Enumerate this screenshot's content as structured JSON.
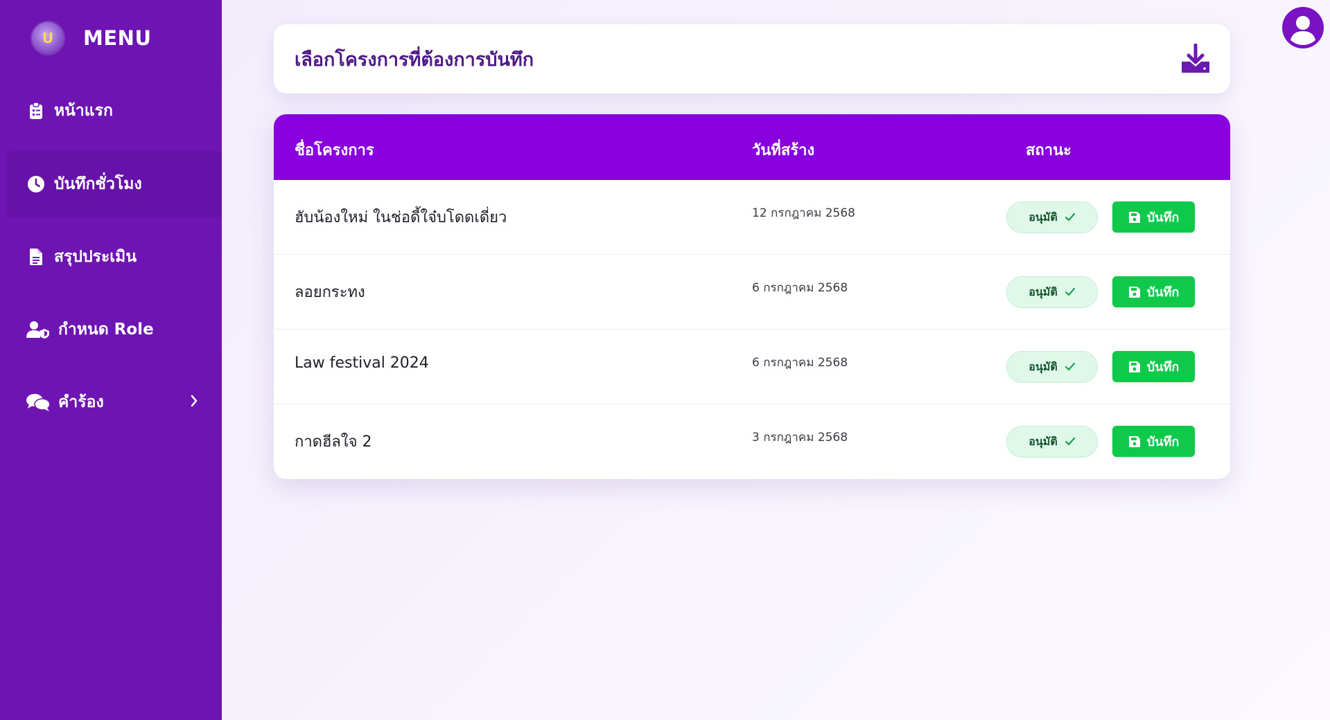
{
  "sidebar": {
    "logo_text": "U",
    "title": "MENU",
    "items": [
      {
        "label": "หน้าแรก",
        "icon": "clipboard-icon"
      },
      {
        "label": "บันทึกชั่วโมง",
        "icon": "clock-icon",
        "active": true
      },
      {
        "label": "สรุปประเมิน",
        "icon": "file-icon"
      },
      {
        "label": "กำหนด Role",
        "icon": "user-shield-icon"
      },
      {
        "label": "คำร้อง",
        "icon": "comments-icon",
        "has_submenu": true
      }
    ]
  },
  "header": {
    "title": "เลือกโครงการที่ต้องการบันทึก",
    "download_icon": "download-icon"
  },
  "table": {
    "columns": [
      "ชื่อโครงการ",
      "วันที่สร้าง",
      "สถานะ"
    ],
    "rows": [
      {
        "name": "ฮับน้องใหม่ ในช่อดี้ใจ๋บโดดเดี่ยว",
        "date": "12 กรกฎาคม 2568",
        "status": "อนุมัติ",
        "action": "บันทึก"
      },
      {
        "name": "ลอยกระทง",
        "date": "6 กรกฎาคม 2568",
        "status": "อนุมัติ",
        "action": "บันทึก"
      },
      {
        "name": "Law festival 2024",
        "date": "6 กรกฎาคม 2568",
        "status": "อนุมัติ",
        "action": "บันทึก"
      },
      {
        "name": "กาดฮีลใจ 2",
        "date": "3 กรกฎาคม 2568",
        "status": "อนุมัติ",
        "action": "บันทึก"
      }
    ]
  },
  "colors": {
    "sidebar": "#6d14b3",
    "accent": "#8800de",
    "header_text": "#4e1a86",
    "success": "#0fc94a",
    "badge_bg": "#dff8ea"
  }
}
